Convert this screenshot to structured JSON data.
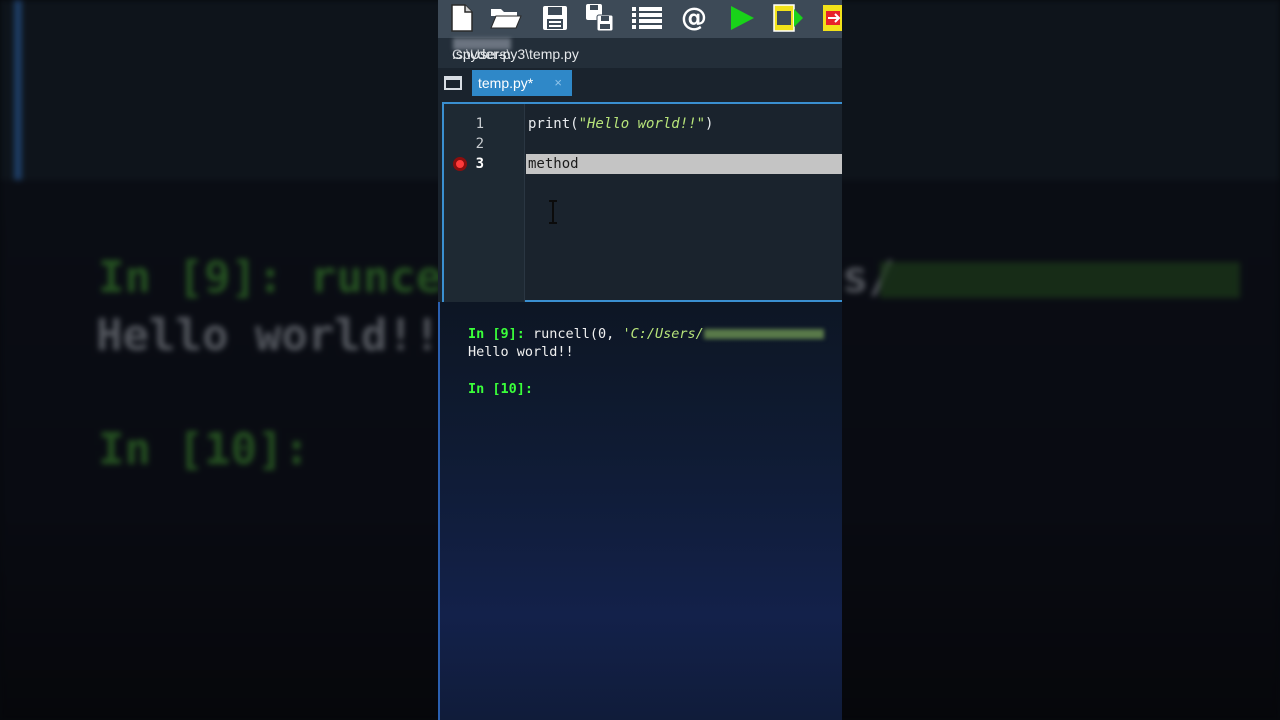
{
  "background": {
    "prompt_in9": "In [9]: runce",
    "output_line": "Hello world!!",
    "prompt_in10": "In [10]:",
    "right_fragment": "s/"
  },
  "toolbar": {
    "icons": [
      "new-file-icon",
      "open-folder-icon",
      "save-icon",
      "save-all-icon",
      "list-icon",
      "at-icon",
      "run-icon",
      "run-cell-icon",
      "run-cell-advance-icon"
    ],
    "at_symbol": "@"
  },
  "path": {
    "prefix": "C:\\Users\\",
    "suffix": ".spyder-py3\\temp.py"
  },
  "tabs": [
    {
      "label": "temp.py*",
      "close": "×"
    }
  ],
  "editor": {
    "lines": [
      {
        "number": "1",
        "pre": "print(",
        "string": "\"Hello world!!\"",
        "post": ")"
      },
      {
        "number": "2",
        "text": ""
      },
      {
        "number": "3",
        "text": "method"
      }
    ]
  },
  "console": {
    "line1_prompt": "In [9]:",
    "line1_code": " runcell(0, ",
    "line1_path": "'C:/Users/",
    "line2": "Hello world!!",
    "line3_prompt": "In [10]:"
  },
  "colors": {
    "toolbar": "#3d4a57",
    "tab_active": "#2f88c8",
    "prompt_green": "#3aff3a",
    "string_green": "#b7e47a",
    "breakpoint_red": "#ff3b3b"
  }
}
